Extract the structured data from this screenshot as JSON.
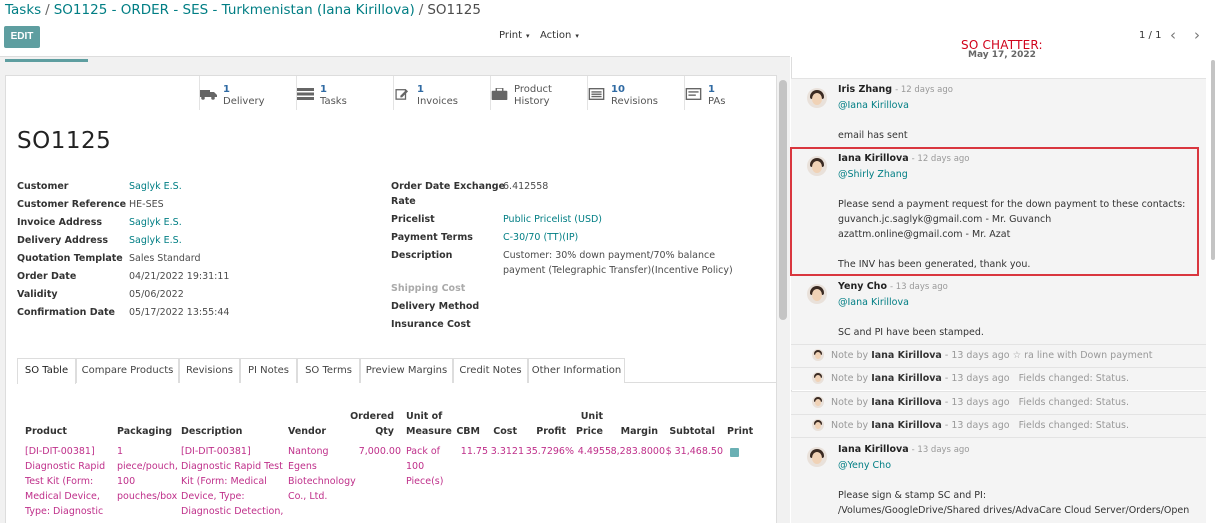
{
  "breadcrumb": {
    "tasks": "Tasks",
    "order": "SO1125 - ORDER - SES - Turkmenistan (Iana Kirillova)",
    "current": "SO1125",
    "separator": "/"
  },
  "controls": {
    "edit": "EDIT",
    "print": "Print",
    "action": "Action",
    "pager": "1 / 1"
  },
  "annotation": "SO CHATTER:",
  "smart_buttons": [
    {
      "count": "1",
      "label": "Delivery",
      "icon": "truck-icon"
    },
    {
      "count": "1",
      "label": "Tasks",
      "icon": "tasks-icon"
    },
    {
      "count": "1",
      "label": "Invoices",
      "icon": "pencil-square-icon"
    },
    {
      "count": "",
      "label": "Product",
      "label2": "History",
      "icon": "briefcase-icon"
    },
    {
      "count": "10",
      "label": "Revisions",
      "icon": "list-icon"
    },
    {
      "count": "1",
      "label": "PAs",
      "icon": "document-icon"
    }
  ],
  "form": {
    "title": "SO1125",
    "left": [
      {
        "label": "Customer",
        "value": "Saglyk E.S."
      },
      {
        "label": "Customer Reference",
        "value": "HE-SES"
      },
      {
        "label": "Invoice Address",
        "value": "Saglyk E.S."
      },
      {
        "label": "Delivery Address",
        "value": "Saglyk E.S."
      },
      {
        "label": "Quotation Template",
        "value": "Sales Standard"
      },
      {
        "label": "Order Date",
        "value": "04/21/2022 19:31:11"
      },
      {
        "label": "Validity",
        "value": "05/06/2022"
      },
      {
        "label": "Confirmation Date",
        "value": "05/17/2022 13:55:44"
      }
    ],
    "right": [
      {
        "label": "Order Date Exchange",
        "label2": "Rate",
        "value": "6.412558"
      },
      {
        "label": "Pricelist",
        "value": "Public Pricelist (USD)"
      },
      {
        "label": "Payment Terms",
        "value": "C-30/70 (TT)(IP)"
      },
      {
        "label": "Description",
        "value": "Customer: 30% down payment/70% balance",
        "value2": "payment (Telegraphic Transfer)(Incentive Policy)"
      },
      {
        "label": "Shipping Cost",
        "value": ""
      },
      {
        "label": "Delivery Method",
        "value": ""
      },
      {
        "label": "Insurance Cost",
        "value": ""
      }
    ]
  },
  "tabs": [
    "SO Table",
    "Compare Products",
    "Revisions",
    "PI Notes",
    "SO Terms",
    "Preview Margins",
    "Credit Notes",
    "Other Information"
  ],
  "table": {
    "headers": {
      "product": "Product",
      "packaging": "Packaging",
      "description": "Description",
      "vendor": "Vendor",
      "ordered_qty": [
        "Ordered",
        "Qty"
      ],
      "uom": [
        "Unit of",
        "Measure"
      ],
      "cbm": "CBM",
      "cost": "Cost",
      "profit": "Profit",
      "unit_price": [
        "Unit",
        "Price"
      ],
      "margin": "Margin",
      "subtotal": "Subtotal",
      "print": "Print"
    },
    "row": {
      "product": [
        "[DI-DIT-00381]",
        "Diagnostic Rapid",
        "Test Kit (Form:",
        "Medical Device,",
        "Type: Diagnostic"
      ],
      "packaging": [
        "1",
        "piece/pouch,",
        "100",
        "pouches/box"
      ],
      "description": [
        "[DI-DIT-00381]",
        "Diagnostic Rapid Test",
        "Kit (Form: Medical",
        "Device, Type:",
        "Diagnostic Detection,"
      ],
      "vendor": [
        "Nantong",
        "Egens",
        "Biotechnology",
        "Co., Ltd."
      ],
      "ordered_qty": "7,000.00",
      "uom": [
        "Pack of",
        "100",
        "Piece(s)"
      ],
      "cbm": "11.75",
      "cost": "3.3121",
      "profit": "35.7296%",
      "unit_price": "4.4955",
      "margin": "8,283.8000",
      "subtotal": "$ 31,468.50"
    }
  },
  "chatter": {
    "date_separator": "May 17, 2022",
    "messages": [
      {
        "author": "Iris Zhang",
        "ago": "- 12 days ago",
        "mention": "@Iana Kirillova",
        "lines": [
          "email has sent"
        ]
      },
      {
        "author": "Iana Kirillova",
        "ago": "- 12 days ago",
        "mention": "@Shirly Zhang",
        "lines": [
          "Please send a payment request for the down payment to these contacts:",
          "guvanch.jc.saglyk@gmail.com - Mr. Guvanch",
          "azattm.online@gmail.com - Mr. Azat",
          "",
          "The INV has been generated, thank you."
        ]
      },
      {
        "author": "Yeny Cho",
        "ago": "- 13 days ago",
        "mention": "@Iana Kirillova",
        "lines": [
          "SC and PI have been stamped."
        ]
      }
    ],
    "notes": [
      {
        "prefix": "Note by",
        "author": "Iana Kirillova",
        "ago": "- 13 days ago",
        "text": "ra line with Down payment",
        "star": true
      },
      {
        "prefix": "Note by",
        "author": "Iana Kirillova",
        "ago": "- 13 days ago",
        "text": "Fields changed: Status."
      },
      {
        "prefix": "Note by",
        "author": "Iana Kirillova",
        "ago": "- 13 days ago",
        "text": "Fields changed: Status."
      },
      {
        "prefix": "Note by",
        "author": "Iana Kirillova",
        "ago": "- 13 days ago",
        "text": "Fields changed: Status."
      }
    ],
    "last": {
      "author": "Iana Kirillova",
      "ago": "- 13 days ago",
      "mention": "@Yeny Cho",
      "lines": [
        "Please sign & stamp SC and PI:",
        "/Volumes/GoogleDrive/Shared drives/AdvaCare Cloud Server/Orders/Open"
      ]
    }
  }
}
